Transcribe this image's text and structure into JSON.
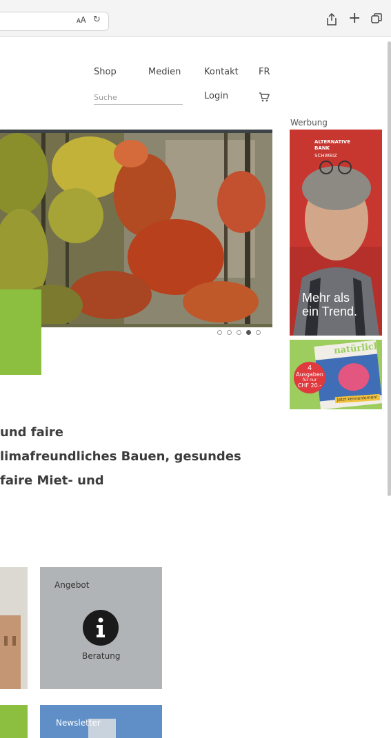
{
  "browser": {
    "toolbar_icons": [
      "translate-icon",
      "reload-icon",
      "share-icon",
      "new-tab-icon",
      "tabs-overview-icon"
    ]
  },
  "nav": {
    "shop": "Shop",
    "medien": "Medien",
    "kontakt": "Kontakt",
    "lang": "FR",
    "search_placeholder": "Suche",
    "login": "Login"
  },
  "hero": {
    "slides": 5,
    "active_slide": 4
  },
  "ads": {
    "label": "Werbung",
    "bank_name": "ALTERNATIVE BANK",
    "bank_sub": "SCHWEIZ",
    "bank_slogan_1": "Mehr als",
    "bank_slogan_2": "ein Trend.",
    "mag_title": "natürlich",
    "mag_badge_1": "4",
    "mag_badge_2": "Ausgaben",
    "mag_badge_3": "für nur",
    "mag_badge_4": "CHF 20.-",
    "mag_cta": "Jetzt kennenlernen!"
  },
  "intro": {
    "line1": "und faire",
    "line2": "limafreundliches Bauen, gesundes",
    "line3": "faire Miet- und"
  },
  "tiles": {
    "angebot_heading": "Angebot",
    "beratung_label": "Beratung",
    "newsletter_label": "Newsletter"
  },
  "colors": {
    "accent_green": "#8cbf3f",
    "tile_grey": "#b1b4b6",
    "ad_red": "#c7362f"
  }
}
